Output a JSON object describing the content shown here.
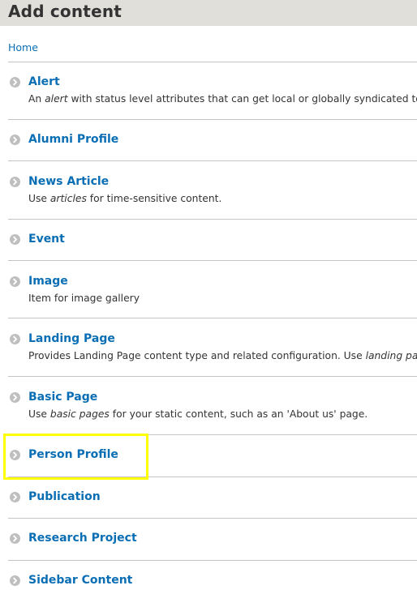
{
  "header": {
    "title": "Add content"
  },
  "breadcrumb": {
    "home_label": "Home"
  },
  "items": [
    {
      "title": "Alert",
      "desc_parts": [
        "An ",
        "alert",
        " with status level attributes that can get local or globally syndicated to o"
      ],
      "icon": "chevron-right-circle-icon"
    },
    {
      "title": "Alumni Profile",
      "desc_parts": null,
      "icon": "chevron-right-circle-icon"
    },
    {
      "title": "News Article",
      "desc_parts": [
        "Use ",
        "articles",
        " for time-sensitive content."
      ],
      "icon": "chevron-right-circle-icon"
    },
    {
      "title": "Event",
      "desc_parts": null,
      "icon": "chevron-right-circle-icon"
    },
    {
      "title": "Image",
      "desc_parts": [
        "Item for image gallery",
        "",
        ""
      ],
      "icon": "chevron-right-circle-icon"
    },
    {
      "title": "Landing Page",
      "desc_parts": [
        "Provides Landing Page content type and related configuration. Use ",
        "landing page",
        ""
      ],
      "icon": "chevron-right-circle-icon"
    },
    {
      "title": "Basic Page",
      "desc_parts": [
        "Use ",
        "basic pages",
        " for your static content, such as an 'About us' page."
      ],
      "icon": "chevron-right-circle-icon"
    },
    {
      "title": "Person Profile",
      "desc_parts": null,
      "icon": "chevron-right-circle-icon",
      "highlighted": true
    },
    {
      "title": "Publication",
      "desc_parts": null,
      "icon": "chevron-right-circle-icon"
    },
    {
      "title": "Research Project",
      "desc_parts": null,
      "icon": "chevron-right-circle-icon"
    },
    {
      "title": "Sidebar Content",
      "desc_parts": null,
      "icon": "chevron-right-circle-icon"
    }
  ],
  "colors": {
    "link": "#0a6eb4",
    "header_bg": "#e0dfd9",
    "highlight": "#ffff00",
    "icon": "#bfbfbf"
  }
}
